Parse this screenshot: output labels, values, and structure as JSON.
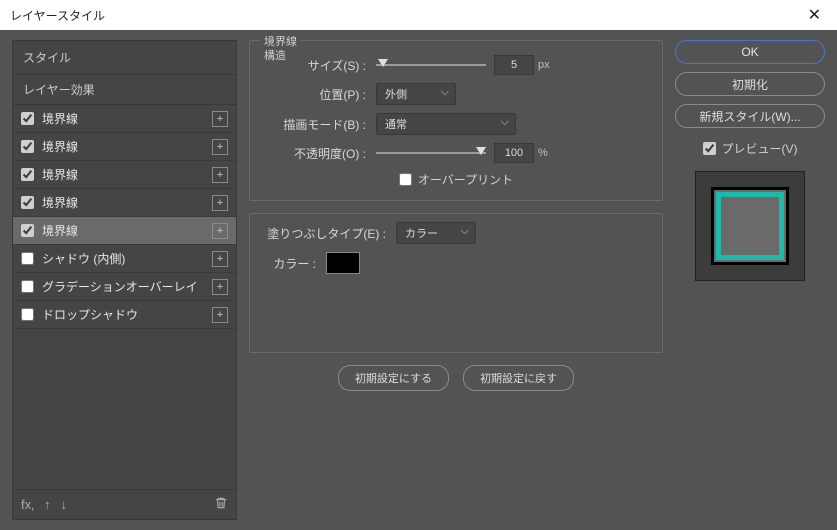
{
  "window": {
    "title": "レイヤースタイル"
  },
  "sidebar": {
    "header": "スタイル",
    "subheader": "レイヤー効果",
    "items": [
      {
        "label": "境界線",
        "checked": true
      },
      {
        "label": "境界線",
        "checked": true
      },
      {
        "label": "境界線",
        "checked": true
      },
      {
        "label": "境界線",
        "checked": true
      },
      {
        "label": "境界線",
        "checked": true
      },
      {
        "label": "シャドウ (内側)",
        "checked": false
      },
      {
        "label": "グラデーションオーバーレイ",
        "checked": false
      },
      {
        "label": "ドロップシャドウ",
        "checked": false
      }
    ]
  },
  "panel1": {
    "legend_line1": "境界線",
    "legend_line2": "構造",
    "size_label": "サイズ(S) :",
    "size_value": "5",
    "size_unit": "px",
    "position_label": "位置(P) :",
    "position_value": "外側",
    "blend_label": "描画モード(B) :",
    "blend_value": "通常",
    "opacity_label": "不透明度(O) :",
    "opacity_value": "100",
    "opacity_unit": "%",
    "overprint_label": "オーバープリント"
  },
  "panel2": {
    "filltype_label": "塗りつぶしタイプ(E) :",
    "filltype_value": "カラー",
    "color_label": "カラー :",
    "color_value": "#000000"
  },
  "buttons": {
    "make_default": "初期設定にする",
    "reset_default": "初期設定に戻す"
  },
  "right": {
    "ok": "OK",
    "reset": "初期化",
    "new_style": "新規スタイル(W)...",
    "preview_label": "プレビュー(V)"
  }
}
